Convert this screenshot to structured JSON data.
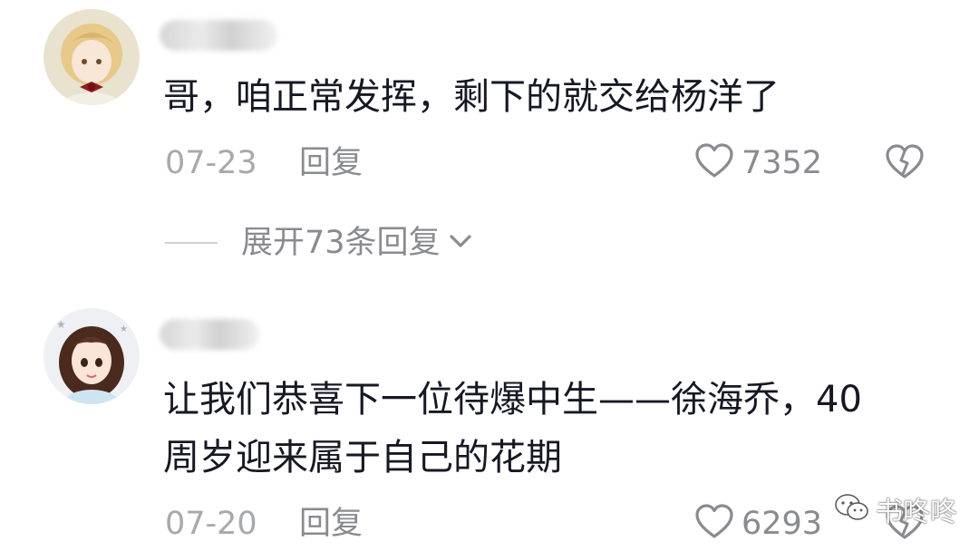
{
  "comments": [
    {
      "text": "哥，咱正常发挥，剩下的就交给杨洋了",
      "date": "07-23",
      "reply_label": "回复",
      "likes": "7352",
      "expand_label": "展开73条回复"
    },
    {
      "text_line1": "让我们恭喜下一位待爆中生——徐海乔，40",
      "text_line2": "周岁迎来属于自己的花期",
      "date": "07-20",
      "reply_label": "回复",
      "likes": "6293"
    }
  ],
  "watermark": {
    "text": "书咚咚"
  },
  "colors": {
    "text_primary": "#161823",
    "text_secondary": "#a8a9ad",
    "icon_gray": "#8a8b91"
  }
}
